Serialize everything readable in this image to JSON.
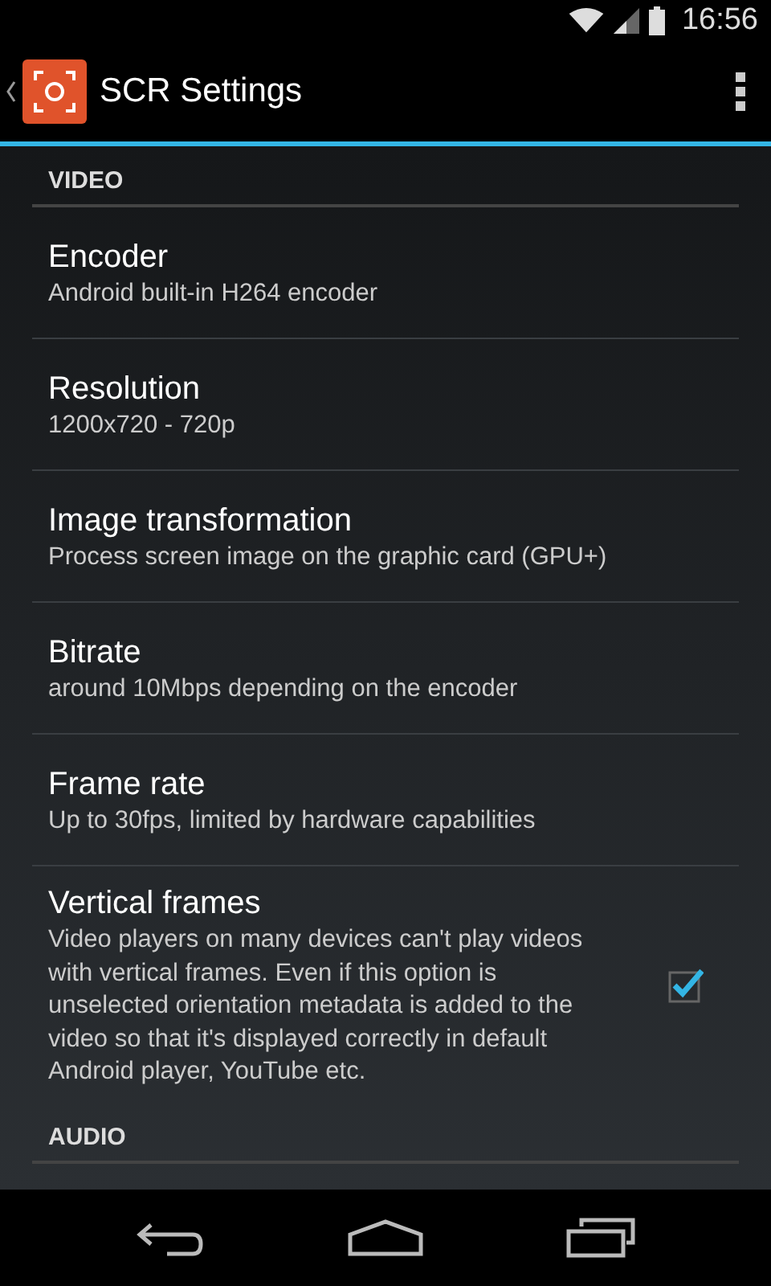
{
  "status_bar": {
    "time": "16:56"
  },
  "action_bar": {
    "title": "SCR Settings"
  },
  "sections": [
    {
      "header": "VIDEO",
      "items": [
        {
          "kind": "text",
          "title": "Encoder",
          "summary": "Android built-in H264 encoder"
        },
        {
          "kind": "text",
          "title": "Resolution",
          "summary": "1200x720 - 720p"
        },
        {
          "kind": "text",
          "title": "Image transformation",
          "summary": "Process screen image on the graphic card (GPU+)"
        },
        {
          "kind": "text",
          "title": "Bitrate",
          "summary": "around 10Mbps depending on the encoder"
        },
        {
          "kind": "text",
          "title": "Frame rate",
          "summary": "Up to 30fps, limited by hardware capabilities"
        },
        {
          "kind": "checkbox",
          "title": "Vertical frames",
          "summary": "Video players on many devices can't play videos with vertical frames. Even if this option is unselected orientation metadata is added to the video so that it's displayed correctly in default Android player, YouTube etc.",
          "checked": true
        }
      ]
    },
    {
      "header": "AUDIO"
    }
  ]
}
